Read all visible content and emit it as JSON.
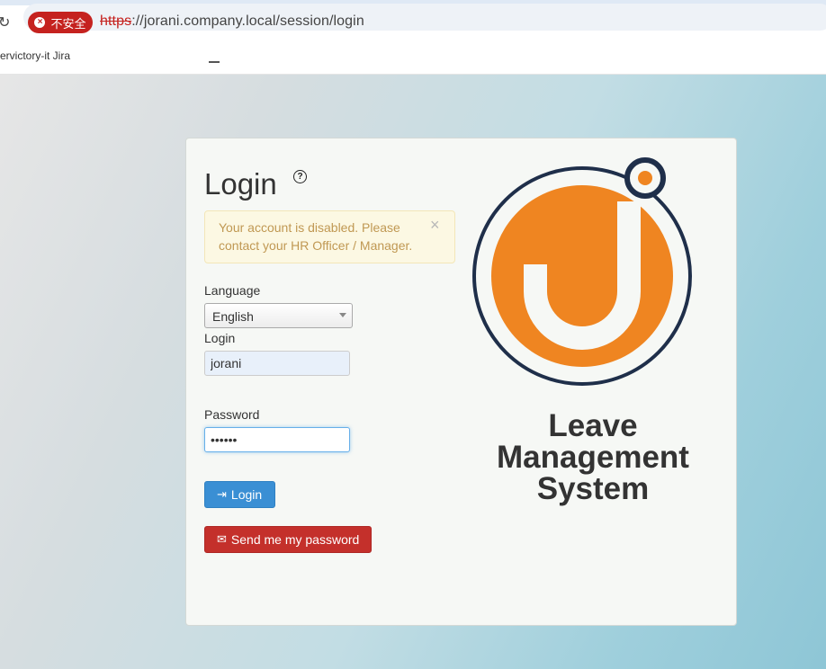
{
  "browser": {
    "security_label": "不安全",
    "url_scheme": "https",
    "url_rest": "://jorani.company.local/session/login",
    "bookmark": "ervictory-it Jira"
  },
  "login_form": {
    "title": "Login",
    "alert_message": "Your account is disabled. Please contact your HR Officer / Manager.",
    "alert_close": "×",
    "language_label": "Language",
    "language_value": "English",
    "login_label": "Login",
    "login_value": "jorani",
    "password_label": "Password",
    "password_value": "••••••",
    "login_button": "Login",
    "send_password_button": "Send me my password"
  },
  "branding": {
    "app_name_line1": "Leave",
    "app_name_line2": "Management",
    "app_name_line3": "System",
    "logo_colors": {
      "orange": "#ef8521",
      "navy": "#1f2f4a"
    }
  },
  "icons": {
    "reload": "reload-icon",
    "security_warning": "error-circle-icon",
    "help": "question-circle-icon",
    "close": "close-icon",
    "login": "sign-in-icon",
    "envelope": "envelope-icon"
  }
}
